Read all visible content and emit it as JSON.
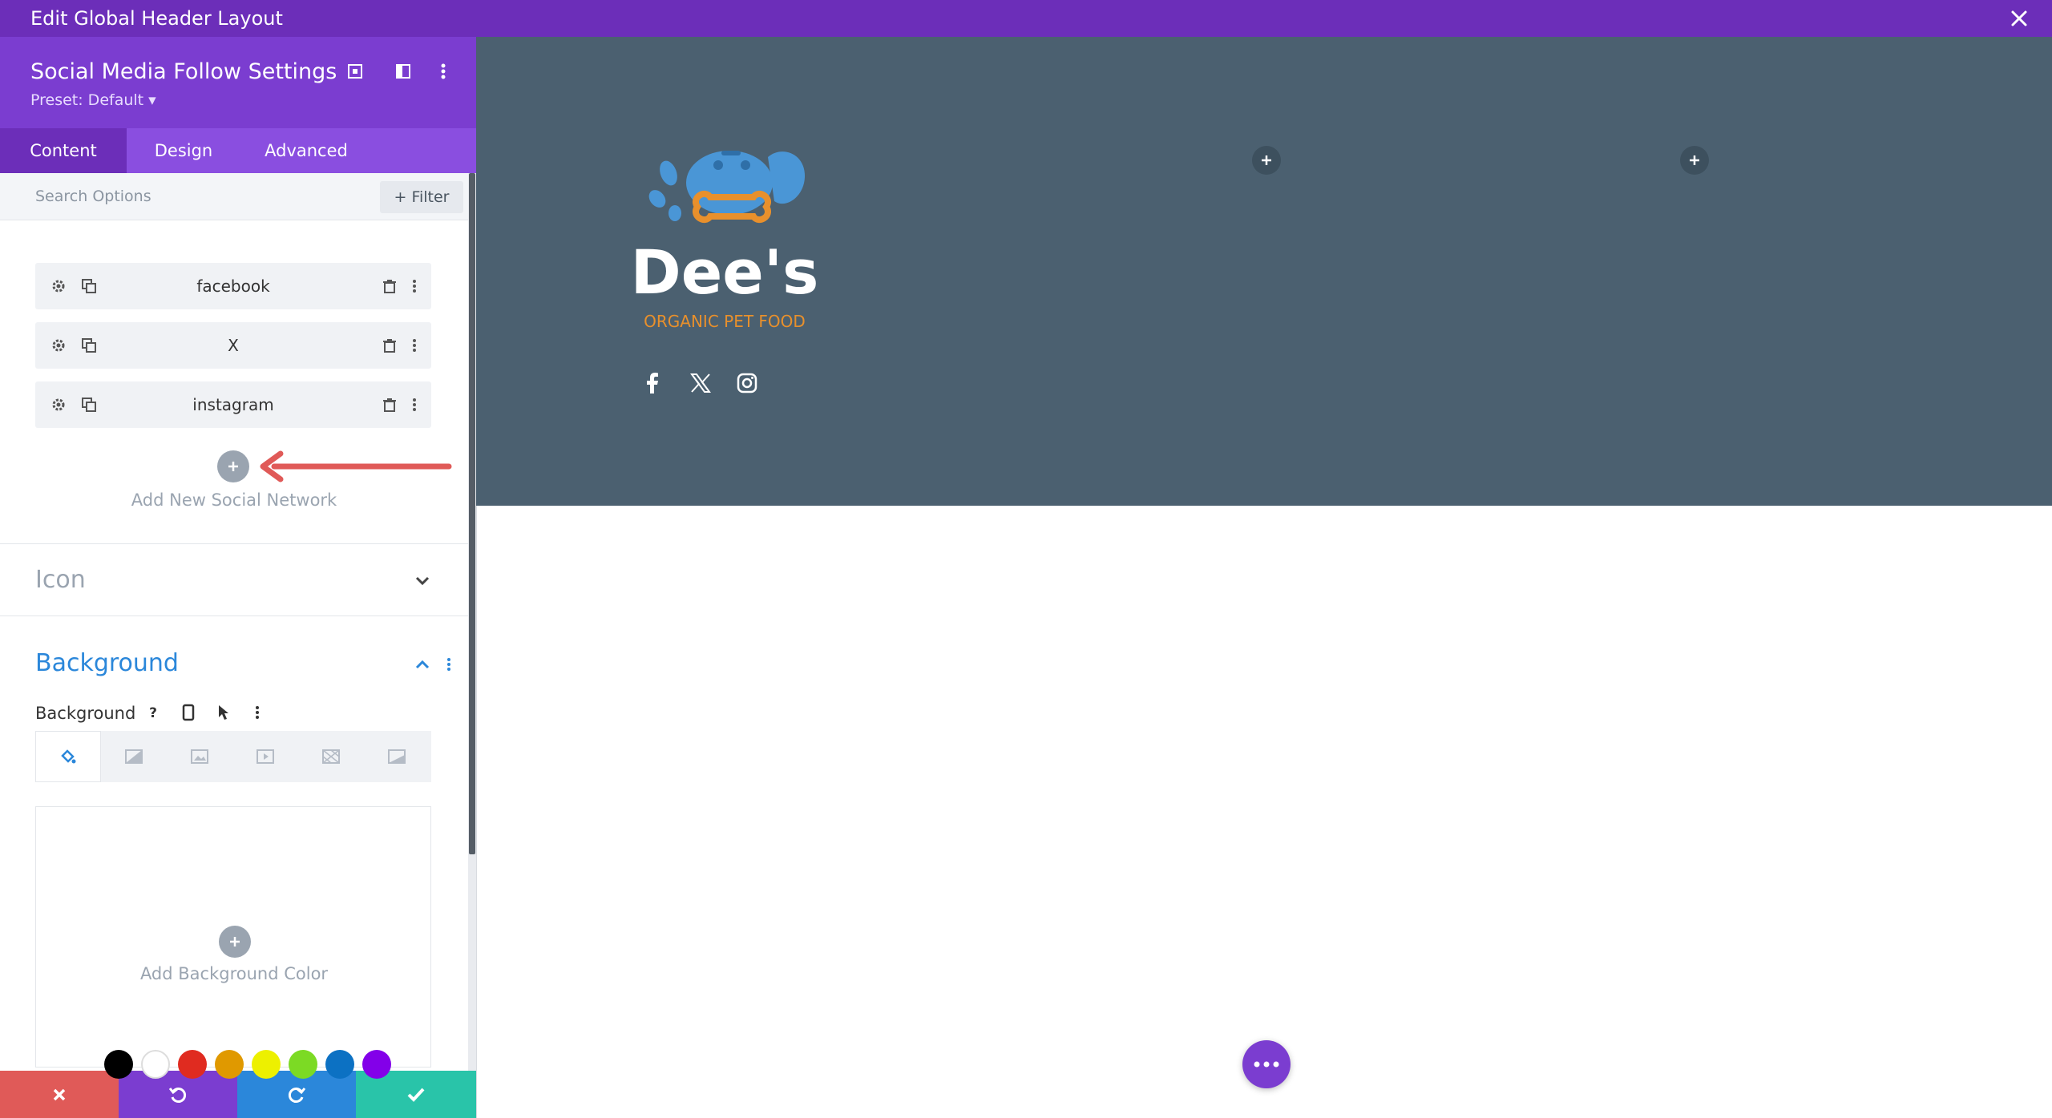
{
  "window": {
    "title": "Edit Global Header Layout"
  },
  "panel": {
    "title": "Social Media Follow Settings",
    "preset": "Preset: Default ▾"
  },
  "tabs": [
    {
      "label": "Content",
      "active": true
    },
    {
      "label": "Design",
      "active": false
    },
    {
      "label": "Advanced",
      "active": false
    }
  ],
  "search": {
    "placeholder": "Search Options",
    "filter_label": "+ Filter"
  },
  "networks": [
    {
      "label": "facebook"
    },
    {
      "label": "X"
    },
    {
      "label": "instagram"
    }
  ],
  "add_network_label": "Add New Social Network",
  "sections": {
    "icon": "Icon",
    "background": "Background"
  },
  "background": {
    "field_label": "Background",
    "add_color_label": "Add Background Color"
  },
  "swatches": [
    "#000000",
    "#ffffff",
    "#e02b20",
    "#e09900",
    "#edf000",
    "#7cda24",
    "#0c71c3",
    "#8300e9"
  ],
  "logo": {
    "name": "Dee's",
    "tagline": "ORGANIC PET FOOD"
  },
  "colors": {
    "topbar": "#6c2eb9",
    "panel_header": "#7b3dd0",
    "canvas_header": "#4b6070",
    "accent_blue": "#2b87da",
    "arrow": "#e05a58"
  }
}
